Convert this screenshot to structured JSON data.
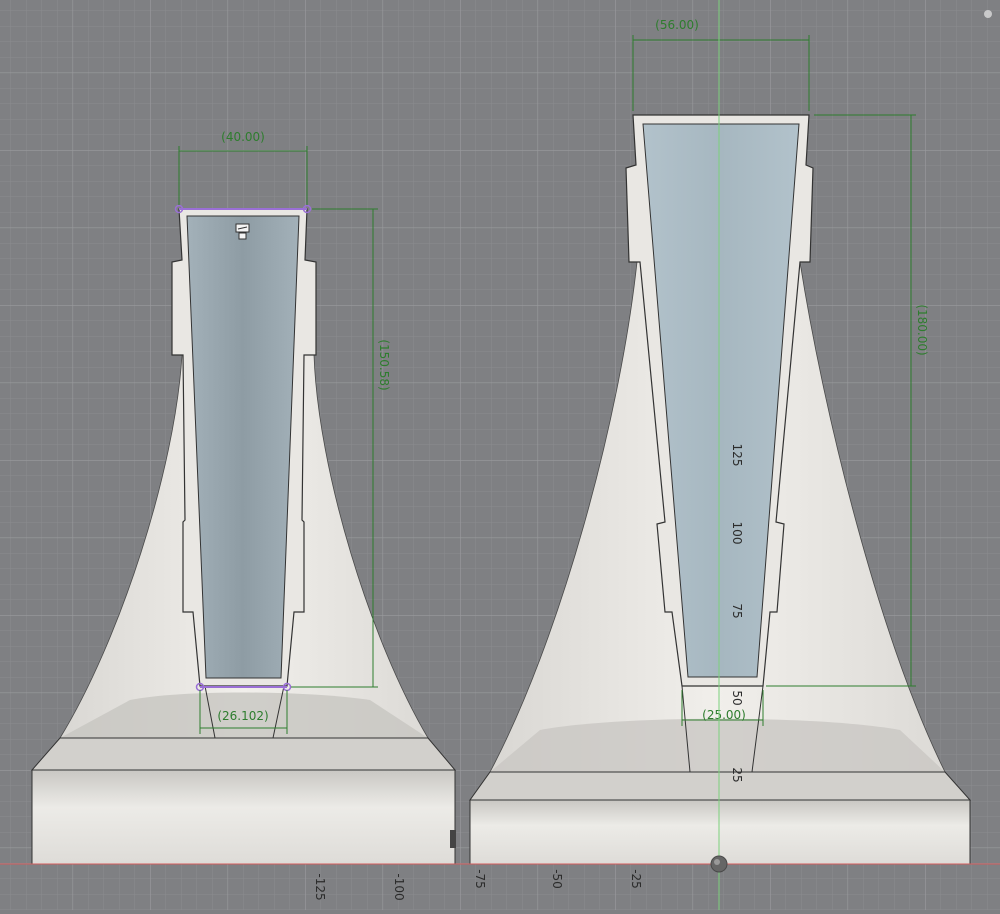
{
  "app": {
    "view": "CAD sketch viewport"
  },
  "colors": {
    "background": "#7f8083",
    "grid_minor": "#8b8c8f",
    "grid_major": "#999a9d",
    "body": "#e7e5e1",
    "dimension": "#2e7d2e",
    "selection": "#9a6fd6",
    "x_axis": "#d35c5c",
    "y_axis": "#7cd17c"
  },
  "left_part": {
    "dim_top_width": "(40.00)",
    "dim_height": "(150.58)",
    "dim_bottom_width": "(26.102)"
  },
  "right_part": {
    "dim_top_width": "(56.00)",
    "dim_height": "(180.00)",
    "dim_bottom_width": "(25.00)"
  },
  "ruler_vertical": [
    "125",
    "100",
    "75",
    "50",
    "25"
  ],
  "ruler_horizontal": [
    "-125",
    "-100",
    "-75",
    "-50",
    "-25"
  ],
  "icons": {
    "sketch_constraint": "lock-constraint-icon",
    "origin": "origin-icon"
  }
}
